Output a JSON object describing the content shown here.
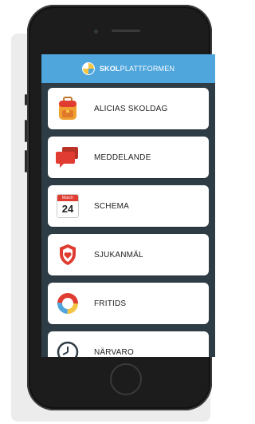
{
  "app": {
    "logo_bold": "SKOL",
    "logo_light": "PLATTFORMEN"
  },
  "menu": {
    "items": [
      {
        "label": "ALICIAS SKOLDAG",
        "icon": "backpack-icon"
      },
      {
        "label": "MEDDELANDE",
        "icon": "chat-bubbles-icon"
      },
      {
        "label": "SCHEMA",
        "icon": "calendar-icon",
        "calendar_month": "March",
        "calendar_day": "24"
      },
      {
        "label": "SJUKANMÄL",
        "icon": "shield-heart-icon"
      },
      {
        "label": "FRITIDS",
        "icon": "ring-icon"
      },
      {
        "label": "NÄRVARO",
        "icon": "clock-icon"
      }
    ]
  },
  "colors": {
    "header": "#4fa6dd",
    "screen_bg": "#2e3c45",
    "accent_red": "#e03c31",
    "accent_orange": "#f0a030"
  }
}
